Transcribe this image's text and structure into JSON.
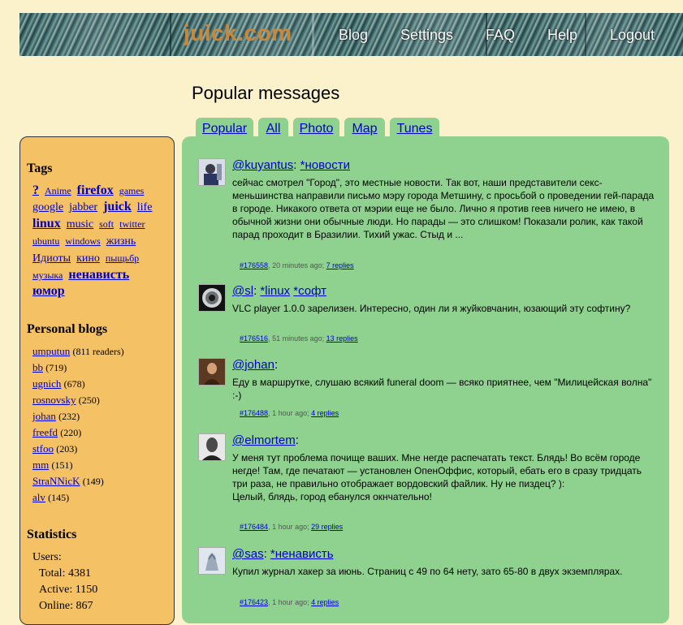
{
  "header": {
    "logo": "juick.com",
    "nav": [
      "Blog",
      "Settings",
      "FAQ",
      "Help",
      "Logout"
    ]
  },
  "page_title": "Popular messages",
  "tabs": [
    "Popular",
    "All",
    "Photo",
    "Map",
    "Tunes"
  ],
  "sidebar": {
    "tags_heading": "Tags",
    "tags": [
      {
        "t": "?",
        "size": "large"
      },
      {
        "t": "Anime",
        "size": "small"
      },
      {
        "t": "firefox",
        "size": "large"
      },
      {
        "t": "games",
        "size": "small"
      },
      {
        "t": "google",
        "size": "medium"
      },
      {
        "t": "jabber",
        "size": "medium"
      },
      {
        "t": "juick",
        "size": "large"
      },
      {
        "t": "life",
        "size": "medium"
      },
      {
        "t": "linux",
        "size": "large"
      },
      {
        "t": "music",
        "size": "medium"
      },
      {
        "t": "soft",
        "size": "small"
      },
      {
        "t": "twitter",
        "size": "small"
      },
      {
        "t": "ubuntu",
        "size": "small"
      },
      {
        "t": "windows",
        "size": "small"
      },
      {
        "t": "жизнь",
        "size": "medium"
      },
      {
        "t": "Идиоты",
        "size": "medium"
      },
      {
        "t": "кино",
        "size": "medium"
      },
      {
        "t": "пыщьбр",
        "size": "small"
      },
      {
        "t": "музыка",
        "size": "small"
      },
      {
        "t": "ненависть",
        "size": "large"
      },
      {
        "t": "юмор",
        "size": "large"
      }
    ],
    "blogs_heading": "Personal blogs",
    "blogs": [
      {
        "name": "umputun",
        "count": "(811 readers)"
      },
      {
        "name": "bb",
        "count": "(719)"
      },
      {
        "name": "ugnich",
        "count": "(678)"
      },
      {
        "name": "rosnovsky",
        "count": "(250)"
      },
      {
        "name": "johan",
        "count": "(232)"
      },
      {
        "name": "freefd",
        "count": "(220)"
      },
      {
        "name": "stfoo",
        "count": "(203)"
      },
      {
        "name": "mm",
        "count": "(151)"
      },
      {
        "name": "StraNNicK",
        "count": "(149)"
      },
      {
        "name": "alv",
        "count": "(145)"
      }
    ],
    "stats_heading": "Statistics",
    "stats_users": "Users:",
    "stats_total": "Total: 4381",
    "stats_active": "Active: 1150",
    "stats_online": "Online: 867"
  },
  "messages": [
    {
      "user": "@kuyantus",
      "sep": ":",
      "tags": [
        "*новости"
      ],
      "text": "сейчас смотрел \"Город\", это местные новости. Так вот, наши представители секс-меньшинства направили письмо мэру города Метшину, с просьбой о проведении гей-парада в городе. Никакого ответа от мэрии еще не было. Лично я против геев ничего не имею, в обычной жизни они обычные люди. Но парады — это слишком! Показали ролик, как такой парад проходит в Бразилии. Тихий ужас. Стыд и ...",
      "id": "#176558",
      "time": "20 minutes ago;",
      "replies": "7 replies"
    },
    {
      "user": "@sl",
      "sep": ":",
      "tags": [
        "*linux",
        "*софт"
      ],
      "text": "VLC player 1.0.0 зарелизен. Интересно, один ли я жуйковчанин, юзающий эту софтину?",
      "id": "#176516",
      "time": "51 minutes ago;",
      "replies": "13 replies"
    },
    {
      "user": "@johan",
      "sep": ":",
      "tags": [],
      "text": "Еду в маршрутке, слушаю всякий funeral doom — всяко приятнее, чем \"Милицейская волна\" :-)",
      "id": "#176488",
      "time": "1 hour ago;",
      "replies": "4 replies"
    },
    {
      "user": "@elmortem",
      "sep": ":",
      "tags": [],
      "text": "У меня тут проблема почище ваших. Мне негде распечатать текст. Блядь! Во всём городе негде! Там, где печатают — установлен ОпенОффис, который, ебать его в сразу тридцать три раза, не правильно отображает вордовский файлик. Ну не пиздец? ):",
      "text2": "Целый, блядь, город ебанулся окнчательно!",
      "id": "#176484",
      "time": "1 hour ago;",
      "replies": "29 replies"
    },
    {
      "user": "@sas",
      "sep": ":",
      "tags": [
        "*ненависть"
      ],
      "text": "Купил журнал хакер за июнь. Страниц с 49 по 64 нету, зато 65-80 в двух экземплярах.",
      "id": "#176423",
      "time": "1 hour ago;",
      "replies": "4 replies"
    }
  ]
}
